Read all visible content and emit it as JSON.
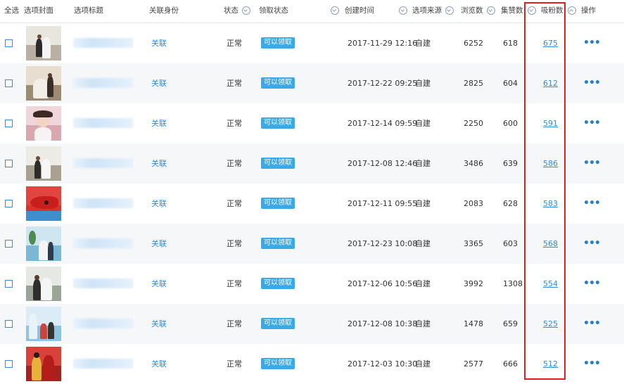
{
  "header": {
    "select_all": "全选",
    "cover": "选项封面",
    "title": "选项标题",
    "identity": "关联身份",
    "status": "状态",
    "claim_status": "领取状态",
    "created_time": "创建时间",
    "source": "选项来源",
    "views": "浏览数",
    "likes": "集赞数",
    "fans": "吸粉数",
    "actions": "操作"
  },
  "rows": [
    {
      "identity": "关联",
      "status": "正常",
      "claim": "可以领取",
      "created": "2017-11-29 12:16",
      "source": "自建",
      "views": "6252",
      "likes": "618",
      "fans": "675",
      "actions": "•••"
    },
    {
      "identity": "关联",
      "status": "正常",
      "claim": "可以领取",
      "created": "2017-12-22 09:25",
      "source": "自建",
      "views": "2825",
      "likes": "604",
      "fans": "612",
      "actions": "•••"
    },
    {
      "identity": "关联",
      "status": "正常",
      "claim": "可以领取",
      "created": "2017-12-14 09:59",
      "source": "自建",
      "views": "2250",
      "likes": "600",
      "fans": "591",
      "actions": "•••"
    },
    {
      "identity": "关联",
      "status": "正常",
      "claim": "可以领取",
      "created": "2017-12-08 12:46",
      "source": "自建",
      "views": "3486",
      "likes": "639",
      "fans": "586",
      "actions": "•••"
    },
    {
      "identity": "关联",
      "status": "正常",
      "claim": "可以领取",
      "created": "2017-12-11 09:55",
      "source": "自建",
      "views": "2083",
      "likes": "628",
      "fans": "583",
      "actions": "•••"
    },
    {
      "identity": "关联",
      "status": "正常",
      "claim": "可以领取",
      "created": "2017-12-23 10:08",
      "source": "自建",
      "views": "3365",
      "likes": "603",
      "fans": "568",
      "actions": "•••"
    },
    {
      "identity": "关联",
      "status": "正常",
      "claim": "可以领取",
      "created": "2017-12-06 10:56",
      "source": "自建",
      "views": "3992",
      "likes": "1308",
      "fans": "554",
      "actions": "•••"
    },
    {
      "identity": "关联",
      "status": "正常",
      "claim": "可以领取",
      "created": "2017-12-08 10:38",
      "source": "自建",
      "views": "1478",
      "likes": "659",
      "fans": "525",
      "actions": "•••"
    },
    {
      "identity": "关联",
      "status": "正常",
      "claim": "可以领取",
      "created": "2017-12-03 10:30",
      "source": "自建",
      "views": "2577",
      "likes": "666",
      "fans": "512",
      "actions": "•••"
    }
  ],
  "colors": {
    "accent": "#2b8ce0",
    "badge": "#39a9e8",
    "highlight": "#e02020"
  }
}
